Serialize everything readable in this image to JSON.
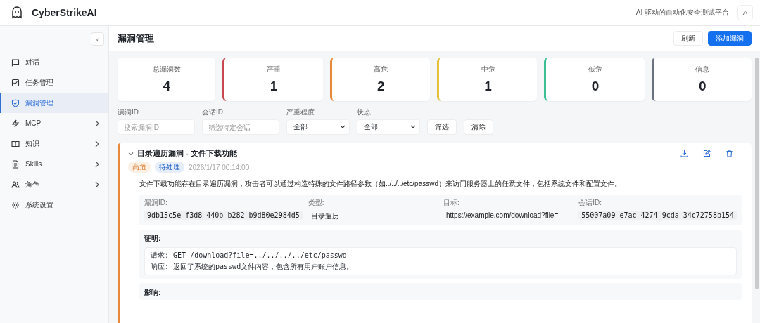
{
  "header": {
    "app_name": "CyberStrikeAI",
    "tagline": "AI 驱动的自动化安全测试平台",
    "avatar": "A"
  },
  "sidebar": {
    "collapse": "‹",
    "items": [
      {
        "label": "对话",
        "selected": false,
        "has_children": false
      },
      {
        "label": "任务管理",
        "selected": false,
        "has_children": false
      },
      {
        "label": "漏洞管理",
        "selected": true,
        "has_children": false
      },
      {
        "label": "MCP",
        "selected": false,
        "has_children": true
      },
      {
        "label": "知识",
        "selected": false,
        "has_children": true
      },
      {
        "label": "Skills",
        "selected": false,
        "has_children": true
      },
      {
        "label": "角色",
        "selected": false,
        "has_children": true
      },
      {
        "label": "系统设置",
        "selected": false,
        "has_children": false
      }
    ]
  },
  "page": {
    "title": "漏洞管理",
    "buttons": [
      {
        "label": "刷新",
        "kind": "secondary"
      },
      {
        "label": "添加漏洞",
        "kind": "primary"
      }
    ]
  },
  "stats": [
    {
      "label": "总漏洞数",
      "value": "4"
    },
    {
      "label": "严重",
      "value": "1",
      "color": "#c9474f"
    },
    {
      "label": "高危",
      "value": "2",
      "color": "#e8883a"
    },
    {
      "label": "中危",
      "value": "1",
      "color": "#e6c03c"
    },
    {
      "label": "低危",
      "value": "0",
      "color": "#3cbf95"
    },
    {
      "label": "信息",
      "value": "0",
      "color": "#6b7280"
    }
  ],
  "filters": [
    {
      "label": "漏洞ID",
      "kind": "input",
      "placeholder": "搜索漏洞ID"
    },
    {
      "label": "会话ID",
      "kind": "input",
      "placeholder": "筛选特定会话"
    },
    {
      "label": "严重程度",
      "kind": "select",
      "value": "全部"
    },
    {
      "label": "状态",
      "kind": "select",
      "value": "全部"
    }
  ],
  "filter_buttons": [
    "筛选",
    "清除"
  ],
  "vulnerability": {
    "title": "目录遍历漏洞 - 文件下载功能",
    "expanded": true,
    "color": "#e8883a",
    "severity": {
      "label": "高危"
    },
    "status": {
      "label": "待处理"
    },
    "time": "2026/1/17 00:14:00",
    "description": "文件下载功能存在目录遍历漏洞，攻击者可以通过构造特殊的文件路径参数（如../../../etc/passwd）来访问服务器上的任意文件，包括系统文件和配置文件。",
    "fields": [
      {
        "label": "漏洞ID:",
        "value": "9db15c5e-f3d8-440b-b282-b9d80e2984d5",
        "kind": "code"
      },
      {
        "label": "类型:",
        "value": "目录遍历",
        "kind": "text"
      },
      {
        "label": "目标:",
        "value": "https://example.com/download?file=",
        "kind": "text"
      },
      {
        "label": "会话ID:",
        "value": "55007a09-e7ac-4274-9cda-34c72758b154",
        "kind": "code"
      }
    ],
    "proof": {
      "label": "证明:",
      "lines": [
        "请求: GET /download?file=../../../../etc/passwd",
        "响应: 返回了系统的passwd文件内容，包含所有用户账户信息。"
      ]
    },
    "impact": {
      "label": "影响:"
    }
  }
}
